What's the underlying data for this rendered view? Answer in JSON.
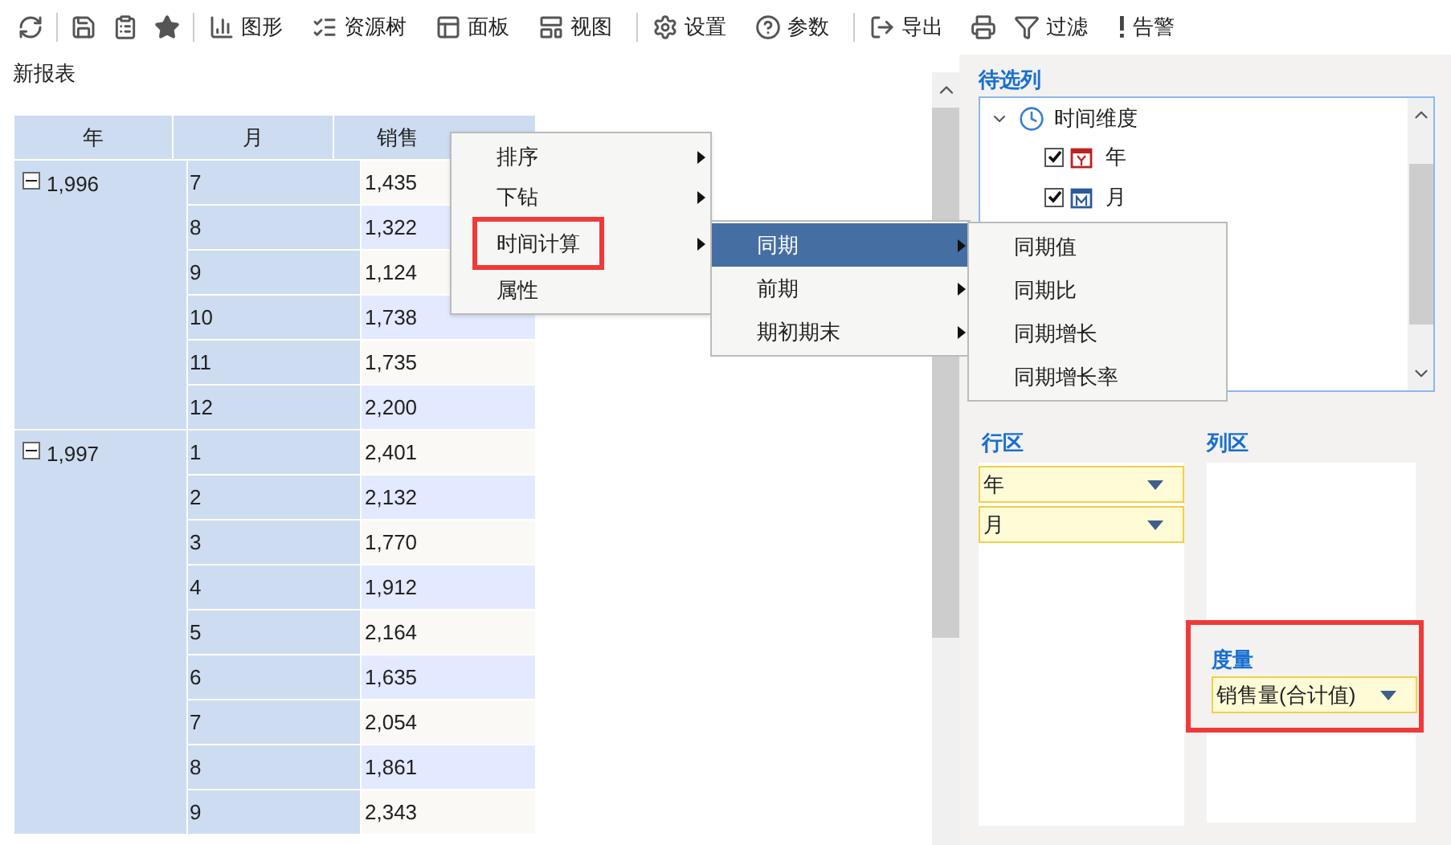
{
  "toolbar": [
    {
      "kind": "icon",
      "separator_after": true
    },
    {
      "kind": "icon",
      "separator_after": false
    },
    {
      "kind": "icon",
      "separator_after": false
    },
    {
      "kind": "icon",
      "separator_after": true
    },
    {
      "kind": "labeled",
      "label": "图形",
      "separator_after": false
    },
    {
      "kind": "labeled",
      "label": "资源树",
      "separator_after": false
    },
    {
      "kind": "labeled",
      "label": "面板",
      "separator_after": false
    },
    {
      "kind": "labeled",
      "label": "视图",
      "separator_after": true
    },
    {
      "kind": "labeled",
      "label": "设置",
      "separator_after": false
    },
    {
      "kind": "labeled",
      "label": "参数",
      "separator_after": true
    },
    {
      "kind": "labeled",
      "label": "导出",
      "separator_after": false
    },
    {
      "kind": "icon",
      "separator_after": false
    },
    {
      "kind": "labeled",
      "label": "过滤",
      "separator_after": false
    },
    {
      "kind": "labeled",
      "label": "告警",
      "separator_after": false
    }
  ],
  "report_title": "新报表",
  "table": {
    "columns": [
      "年",
      "月",
      "销售"
    ],
    "groups": [
      {
        "year": "1,996",
        "expanded": true,
        "rows": [
          [
            "7",
            "1,435"
          ],
          [
            "8",
            "1,322"
          ],
          [
            "9",
            "1,124"
          ],
          [
            "10",
            "1,738"
          ],
          [
            "11",
            "1,735"
          ],
          [
            "12",
            "2,200"
          ]
        ]
      },
      {
        "year": "1,997",
        "expanded": true,
        "rows": [
          [
            "1",
            "2,401"
          ],
          [
            "2",
            "2,132"
          ],
          [
            "3",
            "1,770"
          ],
          [
            "4",
            "1,912"
          ],
          [
            "5",
            "2,164"
          ],
          [
            "6",
            "1,635"
          ],
          [
            "7",
            "2,054"
          ],
          [
            "8",
            "1,861"
          ],
          [
            "9",
            "2,343"
          ]
        ]
      }
    ]
  },
  "context_menu": {
    "items": [
      {
        "label": "排序",
        "has_submenu": true,
        "outlined": false
      },
      {
        "label": "下钻",
        "has_submenu": true,
        "outlined": false
      },
      {
        "label": "时间计算",
        "has_submenu": true,
        "outlined": true
      },
      {
        "label": "属性",
        "has_submenu": false,
        "outlined": false
      }
    ],
    "submenu": [
      {
        "label": "同期",
        "selected": true
      },
      {
        "label": "前期",
        "selected": false
      },
      {
        "label": "期初期末",
        "selected": false
      }
    ],
    "submenu_2": [
      "同期值",
      "同期比",
      "同期增长",
      "同期增长率"
    ]
  },
  "candidate_columns": {
    "title": "待选列",
    "tree": [
      {
        "label": "时间维度",
        "expanded": true,
        "children": [
          {
            "label": "年",
            "checked": true,
            "kind": "year"
          },
          {
            "label": "月",
            "checked": true,
            "kind": "month"
          }
        ]
      }
    ]
  },
  "row_zone": {
    "title": "行区",
    "fields": [
      "年",
      "月"
    ]
  },
  "column_zone": {
    "title": "列区"
  },
  "measure_zone": {
    "title": "度量",
    "outlined": true,
    "fields": [
      "销售量(合计值)"
    ]
  }
}
